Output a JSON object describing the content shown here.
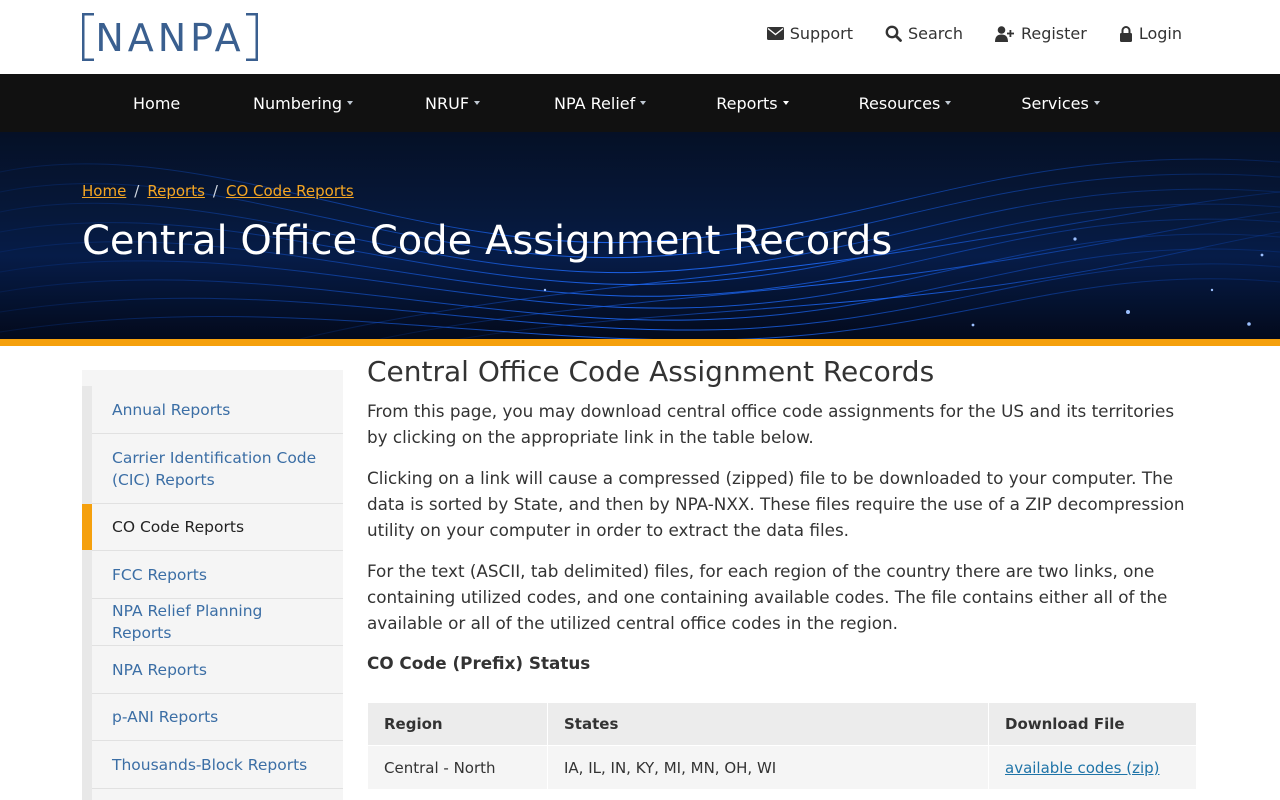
{
  "brand": {
    "logo_text": "NANPA",
    "logo_color": "#3a5f8f"
  },
  "utility_nav": [
    {
      "label": "Support",
      "icon": "envelope-icon"
    },
    {
      "label": "Search",
      "icon": "search-icon"
    },
    {
      "label": "Register",
      "icon": "user-plus-icon"
    },
    {
      "label": "Login",
      "icon": "lock-icon"
    }
  ],
  "main_nav": [
    {
      "label": "Home"
    },
    {
      "label": "Numbering"
    },
    {
      "label": "NRUF"
    },
    {
      "label": "NPA Relief"
    },
    {
      "label": "Reports"
    },
    {
      "label": "Resources"
    },
    {
      "label": "Services"
    }
  ],
  "breadcrumb": [
    "Home",
    "Reports",
    "CO Code Reports"
  ],
  "hero_title": "Central Office Code Assignment Records",
  "sidebar": [
    {
      "label": "Annual Reports"
    },
    {
      "label": "Carrier Identification Code (CIC) Reports"
    },
    {
      "label": "CO Code Reports"
    },
    {
      "label": "FCC Reports"
    },
    {
      "label": "NPA Relief Planning Reports"
    },
    {
      "label": "NPA Reports"
    },
    {
      "label": "p-ANI Reports"
    },
    {
      "label": "Thousands-Block Reports"
    }
  ],
  "content": {
    "title": "Central Office Code Assignment Records",
    "paragraphs": [
      "From this page, you may download central office code assignments for the US and its territories by clicking on the appropriate link in the table below.",
      "Clicking on a link will cause a compressed (zipped) file to be downloaded to your computer. The data is sorted by State, and then by NPA-NXX. These files require the use of a ZIP decompression utility on your computer in order to extract the data files.",
      "For the text (ASCII, tab delimited) files, for each region of the country there are two links, one containing utilized codes, and one containing available codes. The file contains either all of the available or all of the utilized central office codes in the region."
    ],
    "section_heading": "CO Code (Prefix) Status"
  },
  "table": {
    "headers": [
      "Region",
      "States",
      "Download File"
    ],
    "rows": [
      {
        "region": "Central - North",
        "states": "IA, IL, IN, KY, MI, MN, OH, WI",
        "link": "available codes (zip)"
      }
    ]
  },
  "colors": {
    "accent": "#f5a00d",
    "nav_bg": "#111111",
    "link": "#3b6ea5",
    "breadcrumb_link": "#f5a623"
  }
}
